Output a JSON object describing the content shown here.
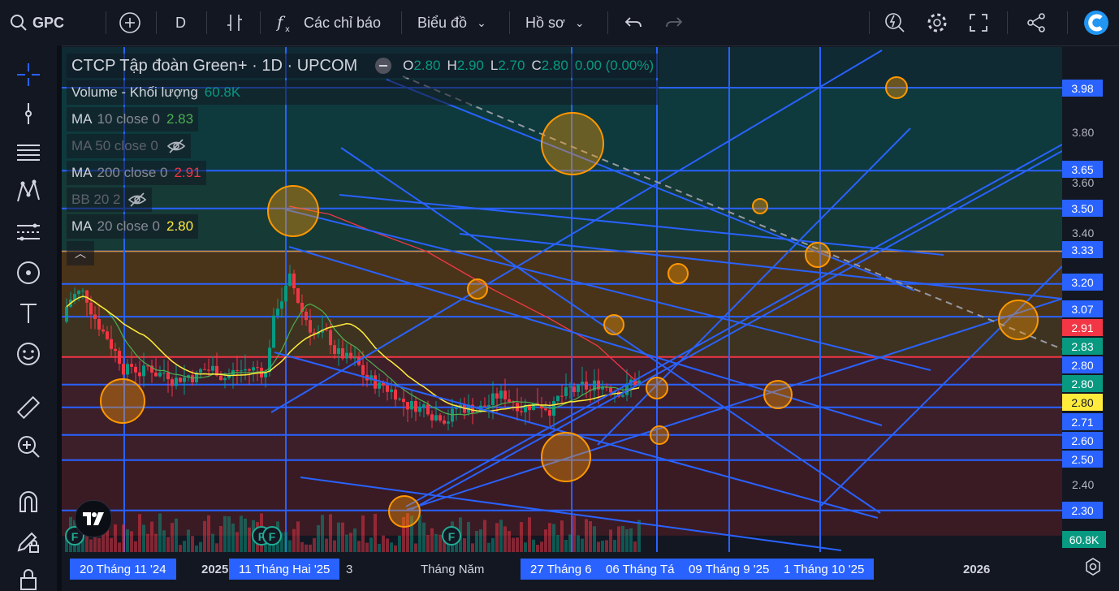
{
  "toolbar": {
    "symbol": "GPC",
    "interval": "D",
    "indicators_label": "Các chỉ báo",
    "chart_type_label": "Biểu đồ",
    "profile_label": "Hồ sơ"
  },
  "legend": {
    "title": "CTCP Tập đoàn Green+ · 1D · UPCOM",
    "ohlc": {
      "o_label": "O",
      "o": "2.80",
      "h_label": "H",
      "h": "2.90",
      "l_label": "L",
      "l": "2.70",
      "c_label": "C",
      "c": "2.80",
      "change": "0.00 (0.00%)"
    },
    "volume": {
      "label": "Volume - Khối lượng",
      "value": "60.8K"
    },
    "ma10": {
      "label": "MA",
      "params": "10 close 0",
      "value": "2.83",
      "color": "#4caf50"
    },
    "ma50": {
      "label": "MA 50 close 0"
    },
    "ma200": {
      "label": "MA",
      "params": "200 close 0",
      "value": "2.91",
      "color": "#f23645"
    },
    "bb": {
      "label": "BB 20 2"
    },
    "ma20": {
      "label": "MA",
      "params": "20 close 0",
      "value": "2.80",
      "color": "#ffeb3b"
    }
  },
  "price_axis": {
    "ticks": [
      "3.80",
      "3.60",
      "3.40",
      "2.40"
    ],
    "labels": [
      {
        "text": "3.98",
        "color": "#2962ff"
      },
      {
        "text": "3.65",
        "color": "#2962ff"
      },
      {
        "text": "3.50",
        "color": "#2962ff"
      },
      {
        "text": "3.33",
        "color": "#2962ff"
      },
      {
        "text": "3.20",
        "color": "#2962ff"
      },
      {
        "text": "3.07",
        "color": "#2962ff"
      },
      {
        "text": "2.91",
        "color": "#f23645"
      },
      {
        "text": "2.83",
        "color": "#089981"
      },
      {
        "text": "2.80",
        "color": "#2962ff"
      },
      {
        "text": "2.80",
        "color": "#089981"
      },
      {
        "text": "2.80",
        "color": "#ffeb3b"
      },
      {
        "text": "2.71",
        "color": "#2962ff"
      },
      {
        "text": "2.60",
        "color": "#2962ff"
      },
      {
        "text": "2.50",
        "color": "#2962ff"
      },
      {
        "text": "2.30",
        "color": "#2962ff"
      },
      {
        "text": "60.8K",
        "color": "#089981"
      }
    ]
  },
  "time_axis": [
    {
      "text": "20 Tháng 11 '24",
      "highlight": true
    },
    {
      "text": "2025",
      "highlight": false
    },
    {
      "text": "11 Tháng Hai '25",
      "highlight": true
    },
    {
      "text": "3",
      "highlight": false
    },
    {
      "text": "Tháng Năm",
      "highlight": false
    },
    {
      "text": "27 Tháng 6",
      "highlight": true
    },
    {
      "text": "06 Tháng Tá",
      "highlight": true
    },
    {
      "text": "09 Tháng 9 '25",
      "highlight": true
    },
    {
      "text": "1 Tháng 10 '25",
      "highlight": true
    },
    {
      "text": "2026",
      "highlight": false
    }
  ],
  "events": [
    "F",
    "F",
    "F",
    "F"
  ],
  "colors": {
    "up": "#089981",
    "down": "#f23645",
    "drawing": "#2962ff",
    "circle": "#ff9800",
    "bg": "#131722"
  }
}
